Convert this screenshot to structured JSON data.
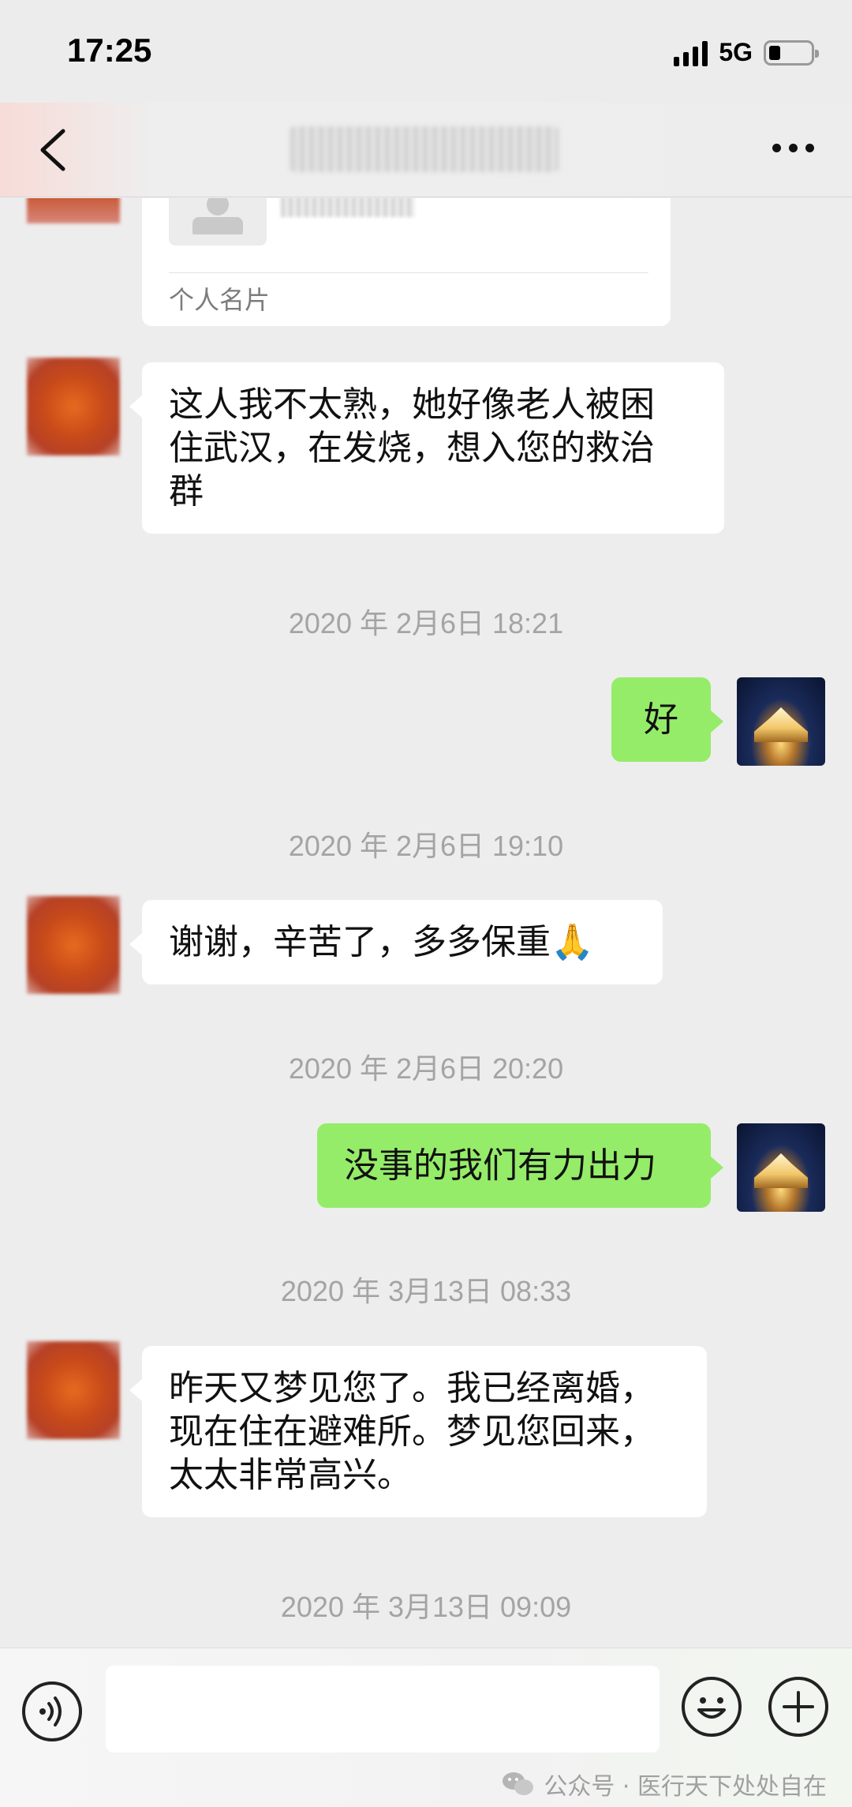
{
  "status_bar": {
    "time": "17:25",
    "network": "5G"
  },
  "contact_card": {
    "label": "个人名片"
  },
  "messages": [
    {
      "side": "left",
      "text_lines": [
        "这人我不太熟，她好像老人被困",
        "住武汉，在发烧，想入您的救治",
        "群"
      ]
    },
    {
      "timestamp": "2020 年 2月6日 18:21"
    },
    {
      "side": "right",
      "text": "好"
    },
    {
      "timestamp": "2020 年 2月6日 19:10"
    },
    {
      "side": "left",
      "text": "谢谢，辛苦了，多多保重🙏"
    },
    {
      "timestamp": "2020 年 2月6日 20:20"
    },
    {
      "side": "right",
      "text": "没事的我们有力出力"
    },
    {
      "timestamp": "2020 年 3月13日 08:33"
    },
    {
      "side": "left",
      "text_lines": [
        "昨天又梦见您了。我已经离婚，",
        "现在住在避难所。梦见您回来，",
        "太太非常高兴。"
      ]
    },
    {
      "timestamp": "2020 年 3月13日 09:09"
    }
  ],
  "watermark": {
    "text": "公众号 · 医行天下处处自在"
  },
  "icons": {
    "back": "chevron-left-icon",
    "more": "more-dots-icon",
    "voice": "voice-icon",
    "emoji": "emoji-icon",
    "plus": "plus-icon",
    "wechat": "wechat-icon"
  },
  "colors": {
    "sent_bubble": "#95ec69",
    "received_bubble": "#ffffff",
    "background": "#ededed"
  }
}
